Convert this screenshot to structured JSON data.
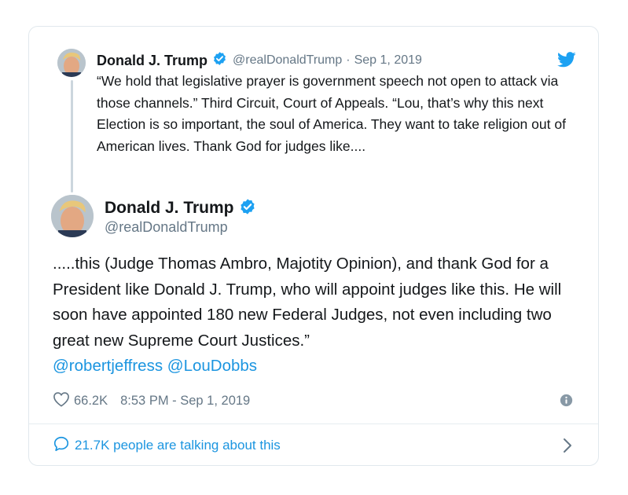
{
  "reply_tweet": {
    "name": "Donald J. Trump",
    "handle": "@realDonaldTrump",
    "separator": "·",
    "date": "Sep 1, 2019",
    "text": "“We hold that legislative prayer is government speech not open to attack via those channels.” Third Circuit, Court of Appeals. “Lou, that’s why this next Election is so important, the soul of America. They want to take religion out of American lives. Thank God for judges like...."
  },
  "main_tweet": {
    "name": "Donald J. Trump",
    "handle": "@realDonaldTrump",
    "text": ".....this (Judge Thomas Ambro, Majotity Opinion), and thank God for a President like Donald J. Trump, who will appoint judges like this. He will soon have appointed 180 new Federal Judges, not even including two great new Supreme Court Justices.”",
    "mentions": [
      "@robertjeffress",
      "@LouDobbs"
    ],
    "likes": "66.2K",
    "timestamp": "8:53 PM - Sep 1, 2019"
  },
  "footer": {
    "talking_text": "21.7K people are talking about this"
  },
  "icons": {
    "brand": "twitter-bird-icon",
    "verified": "verified-badge-icon",
    "like": "heart-icon",
    "info": "info-icon",
    "reply": "speech-bubble-icon",
    "chevron": "chevron-right-icon"
  },
  "colors": {
    "twitter_blue": "#1da1f2",
    "link_blue": "#1b95e0",
    "secondary_text": "#657786",
    "border": "#e1e8ed"
  }
}
